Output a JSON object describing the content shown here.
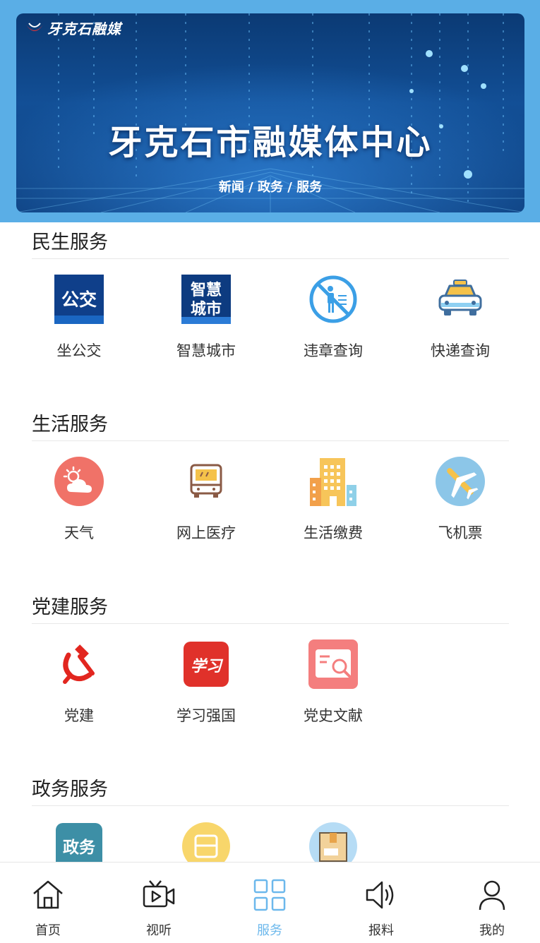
{
  "banner": {
    "logo_text": "牙克石融媒",
    "title": "牙克石市融媒体中心",
    "subtitle": "新闻 / 政务 / 服务"
  },
  "sections": [
    {
      "title": "民生服务",
      "items": [
        {
          "label": "坐公交",
          "icon": "bus-card-icon",
          "icon_text": "公交"
        },
        {
          "label": "智慧城市",
          "icon": "smart-city-icon",
          "icon_text_1": "智慧",
          "icon_text_2": "城市"
        },
        {
          "label": "违章查询",
          "icon": "no-pedestrian-icon"
        },
        {
          "label": "快递查询",
          "icon": "taxi-icon"
        }
      ]
    },
    {
      "title": "生活服务",
      "items": [
        {
          "label": "天气",
          "icon": "weather-icon"
        },
        {
          "label": "网上医疗",
          "icon": "bus-front-icon"
        },
        {
          "label": "生活缴费",
          "icon": "buildings-icon"
        },
        {
          "label": "飞机票",
          "icon": "airplane-icon"
        }
      ]
    },
    {
      "title": "党建服务",
      "items": [
        {
          "label": "党建",
          "icon": "hammer-sickle-icon"
        },
        {
          "label": "学习强国",
          "icon": "xuexi-icon",
          "icon_text": "学习"
        },
        {
          "label": "党史文献",
          "icon": "document-search-icon"
        }
      ]
    },
    {
      "title": "政务服务",
      "items": [
        {
          "label": "",
          "icon": "government-icon",
          "icon_text": "政务"
        },
        {
          "label": "",
          "icon": "bus-yellow-icon"
        },
        {
          "label": "",
          "icon": "package-icon"
        }
      ]
    }
  ],
  "tabbar": {
    "active": "服务",
    "tabs": [
      {
        "label": "首页",
        "icon": "home-icon"
      },
      {
        "label": "视听",
        "icon": "video-icon"
      },
      {
        "label": "服务",
        "icon": "grid-icon"
      },
      {
        "label": "报料",
        "icon": "speaker-icon"
      },
      {
        "label": "我的",
        "icon": "user-icon"
      }
    ]
  },
  "colors": {
    "header_bg": "#5aaee6",
    "accent": "#6cb8ec",
    "banner_dark": "#0b3a74"
  }
}
